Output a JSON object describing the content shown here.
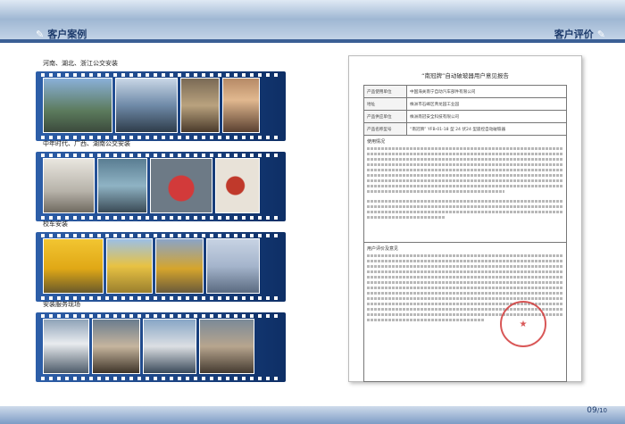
{
  "header": {
    "left_title": "客户案例",
    "right_title": "客户评价"
  },
  "sections": [
    {
      "label": "河南、湖北、浙江公交安装"
    },
    {
      "label": "中年时代、广西、湖南公交安装"
    },
    {
      "label": "校车安装"
    },
    {
      "label": "安装服务现场"
    }
  ],
  "colors": {
    "accent": "#1c3a6b",
    "strip": "#0e2f66",
    "stamp": "#d23a3a"
  },
  "document": {
    "title": "“南冠牌”自动破玻器用户意见报告",
    "rows": [
      {
        "key": "产品使用单位",
        "value": "中国海关南宁自动汽车部件有限公司"
      },
      {
        "key": "地址",
        "value": "株洲市石峰区青龙园工业园"
      },
      {
        "key": "产品供应单位",
        "value": "株洲南冠安全科技有限公司"
      },
      {
        "key": "产品名称型号",
        "value": "“南冠牌” YFB-01-18 型 24 伏24 型遥控自动破玻器"
      }
    ],
    "usage_title": "使用情况",
    "eval_title": "用户评价及意见",
    "stamp_text": "株洲市公共交通有限责任公司"
  },
  "footer": {
    "page": "09",
    "total": "/10"
  }
}
